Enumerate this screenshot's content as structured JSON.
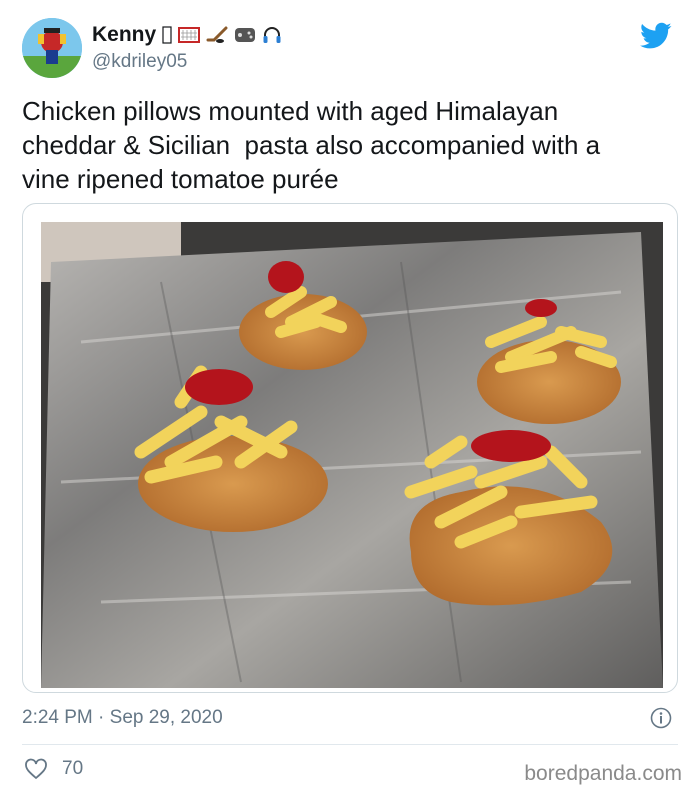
{
  "user": {
    "display_name": "Kenny",
    "handle": "@kdriley05",
    "name_emojis": [
      "box-glyph-icon",
      "hockey-net-icon",
      "hockey-stick-icon",
      "game-controller-icon",
      "headphones-icon"
    ]
  },
  "tweet": {
    "text": "Chicken pillows mounted with aged Himalayan\ncheddar & Sicilian  pasta also accompanied with a\nvine ripened tomatoe purée",
    "media_description_icon": "food-photo"
  },
  "meta": {
    "timestamp": "2:24 PM · Sep 29, 2020",
    "likes": "70"
  },
  "footer": {
    "credit": "boredpanda.com"
  },
  "colors": {
    "twitter_blue": "#1da1f2",
    "text": "#14171a",
    "muted": "#657786"
  }
}
